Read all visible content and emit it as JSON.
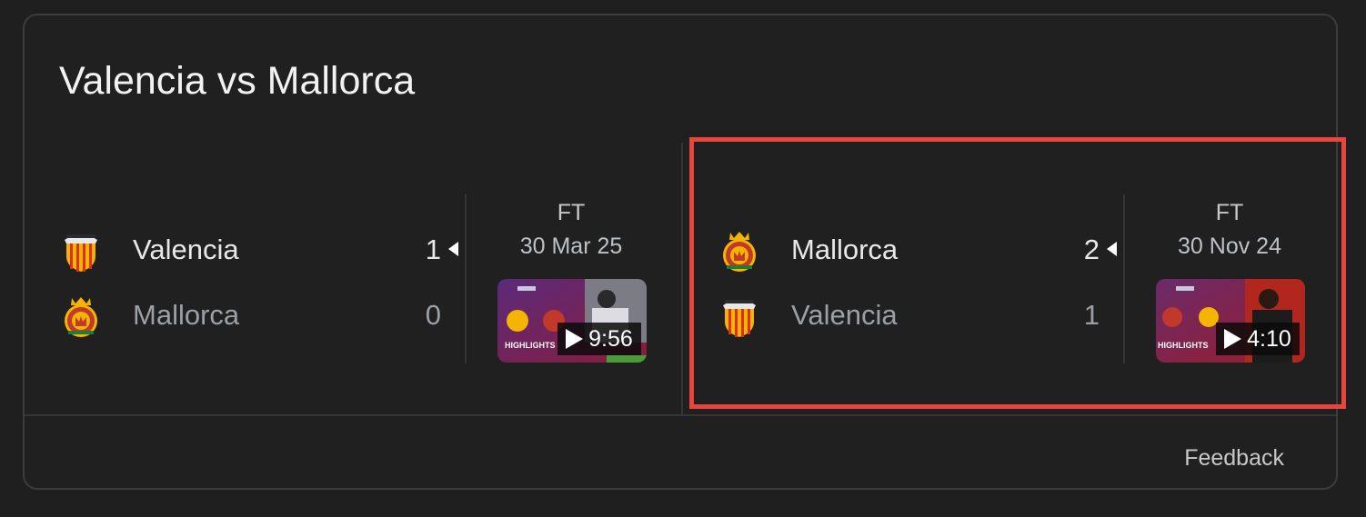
{
  "card": {
    "title": "Valencia vs Mallorca",
    "feedback_label": "Feedback"
  },
  "matches": [
    {
      "status": "FT",
      "date": "30 Mar 25",
      "teams": [
        {
          "name": "Valencia",
          "score": "1",
          "winner": true
        },
        {
          "name": "Mallorca",
          "score": "0",
          "winner": false
        }
      ],
      "video": {
        "duration": "9:56",
        "thumbnail_text": "HIGHLIGHTS"
      }
    },
    {
      "status": "FT",
      "date": "30 Nov 24",
      "teams": [
        {
          "name": "Mallorca",
          "score": "2",
          "winner": true
        },
        {
          "name": "Valencia",
          "score": "1",
          "winner": false
        }
      ],
      "video": {
        "duration": "4:10",
        "thumbnail_text": "HIGHLIGHTS"
      },
      "highlighted": true
    }
  ],
  "colors": {
    "background": "#1f1f1f",
    "card_border": "#3c3c3c",
    "highlight": "#e8453c",
    "valencia_orange": "#f39c12",
    "mallorca_red": "#c0392b"
  },
  "icons": [
    "valencia-crest-icon",
    "mallorca-crest-icon",
    "play-icon",
    "winner-arrow-icon"
  ]
}
